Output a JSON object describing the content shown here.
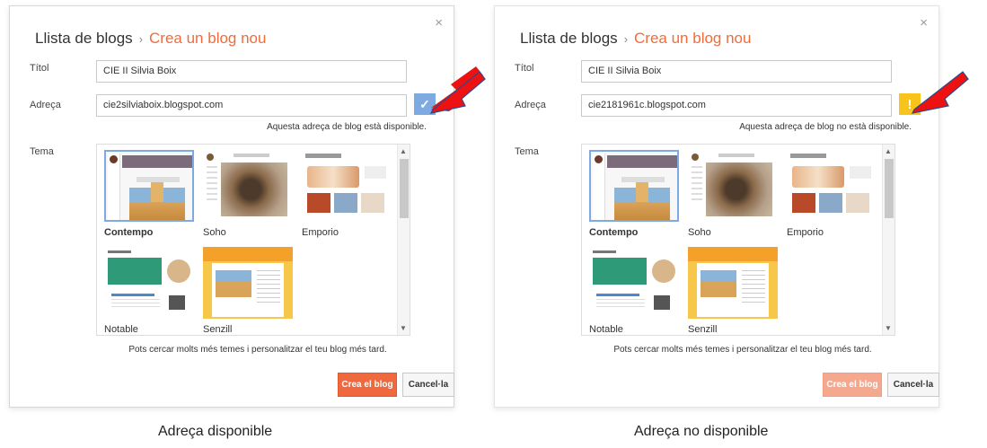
{
  "left": {
    "breadcrumb_root": "Llista de blogs",
    "breadcrumb_sep": "›",
    "breadcrumb_current": "Crea un blog nou",
    "title_label": "Títol",
    "title_value": "CIE II Silvia Boix",
    "address_label": "Adreça",
    "address_value": "cie2silviaboix.blogspot.com",
    "status_icon": "✓",
    "availability": "Aquesta adreça de blog està disponible.",
    "theme_label": "Tema",
    "themes": [
      "Contempo",
      "Soho",
      "Emporio",
      "Notable",
      "Senzill"
    ],
    "hint": "Pots cercar molts més temes i personalitzar el teu blog més tard.",
    "create_button": "Crea el blog",
    "cancel_button": "Cancel·la",
    "close_icon": "×",
    "caption": "Adreça disponible"
  },
  "right": {
    "breadcrumb_root": "Llista de blogs",
    "breadcrumb_sep": "›",
    "breadcrumb_current": "Crea un blog nou",
    "title_label": "Títol",
    "title_value": "CIE II Silvia Boix",
    "address_label": "Adreça",
    "address_value": "cie2181961c.blogspot.com",
    "status_icon": "!",
    "availability": "Aquesta adreça de blog no està disponible.",
    "theme_label": "Tema",
    "themes": [
      "Contempo",
      "Soho",
      "Emporio",
      "Notable",
      "Senzill"
    ],
    "hint": "Pots cercar molts més temes i personalitzar el teu blog més tard.",
    "create_button": "Crea el blog",
    "cancel_button": "Cancel·la",
    "close_icon": "×",
    "caption": "Adreça no disponible"
  },
  "colors": {
    "accent": "#f26b3a",
    "create_button": "#f0683d",
    "ok_status": "#7daae0",
    "warn_status": "#f8c41b",
    "arrow": "#ee1111"
  }
}
